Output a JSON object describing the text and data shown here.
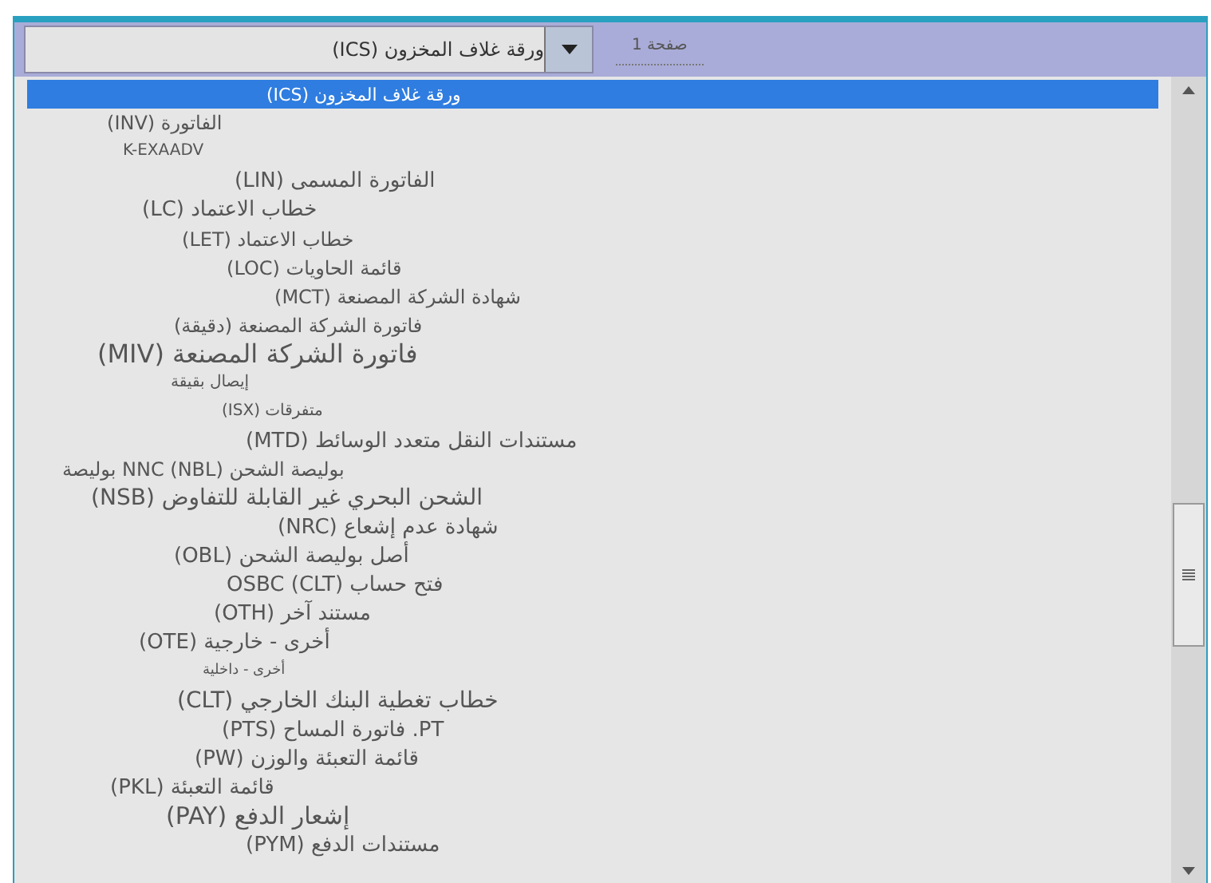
{
  "combo": {
    "value": "ورقة غلاف المخزون (ICS)"
  },
  "tab": {
    "label": "صفحة 1"
  },
  "list": {
    "items": [
      {
        "label": "ورقة غلاف المخزون (ICS)",
        "selected": true
      },
      {
        "label": "الفاتورة (INV)",
        "selected": false
      },
      {
        "label": "K-EXAADV",
        "selected": false
      },
      {
        "label": "الفاتورة المسمى (LIN)",
        "selected": false
      },
      {
        "label": "خطاب الاعتماد (LC)",
        "selected": false
      },
      {
        "label": "خطاب الاعتماد (LET)",
        "selected": false
      },
      {
        "label": "قائمة الحاويات (LOC)",
        "selected": false
      },
      {
        "label": "شهادة الشركة المصنعة (MCT)",
        "selected": false
      },
      {
        "label": "فاتورة الشركة المصنعة (دقيقة)",
        "selected": false
      },
      {
        "label": "فاتورة الشركة المصنعة (MIV)",
        "selected": false
      },
      {
        "label": "إيصال بقيقة",
        "selected": false
      },
      {
        "label": "متفرقات (ISX)",
        "selected": false
      },
      {
        "label": "مستندات النقل متعدد الوسائط (MTD)",
        "selected": false
      },
      {
        "label": "بوليصة الشحن (NBL) NNC بوليصة",
        "selected": false
      },
      {
        "label": "الشحن البحري غير القابلة للتفاوض (NSB)",
        "selected": false
      },
      {
        "label": "شهادة عدم إشعاع (NRC)",
        "selected": false
      },
      {
        "label": "أصل بوليصة الشحن (OBL)",
        "selected": false
      },
      {
        "label": "فتح حساب (CLT) OSBC",
        "selected": false
      },
      {
        "label": "مستند آخر (OTH)",
        "selected": false
      },
      {
        "label": "أخرى - خارجية (OTE)",
        "selected": false
      },
      {
        "label": "أخرى - داخلية",
        "selected": false
      },
      {
        "label": "خطاب تغطية البنك الخارجي (CLT)",
        "selected": false
      },
      {
        "label": "PT. فاتورة المساح (PTS)",
        "selected": false
      },
      {
        "label": "قائمة التعبئة والوزن (PW)",
        "selected": false
      },
      {
        "label": "قائمة التعبئة (PKL)",
        "selected": false
      },
      {
        "label": "إشعار الدفع (PAY)",
        "selected": false
      },
      {
        "label": "مستندات الدفع (PYM)",
        "selected": false
      }
    ]
  }
}
